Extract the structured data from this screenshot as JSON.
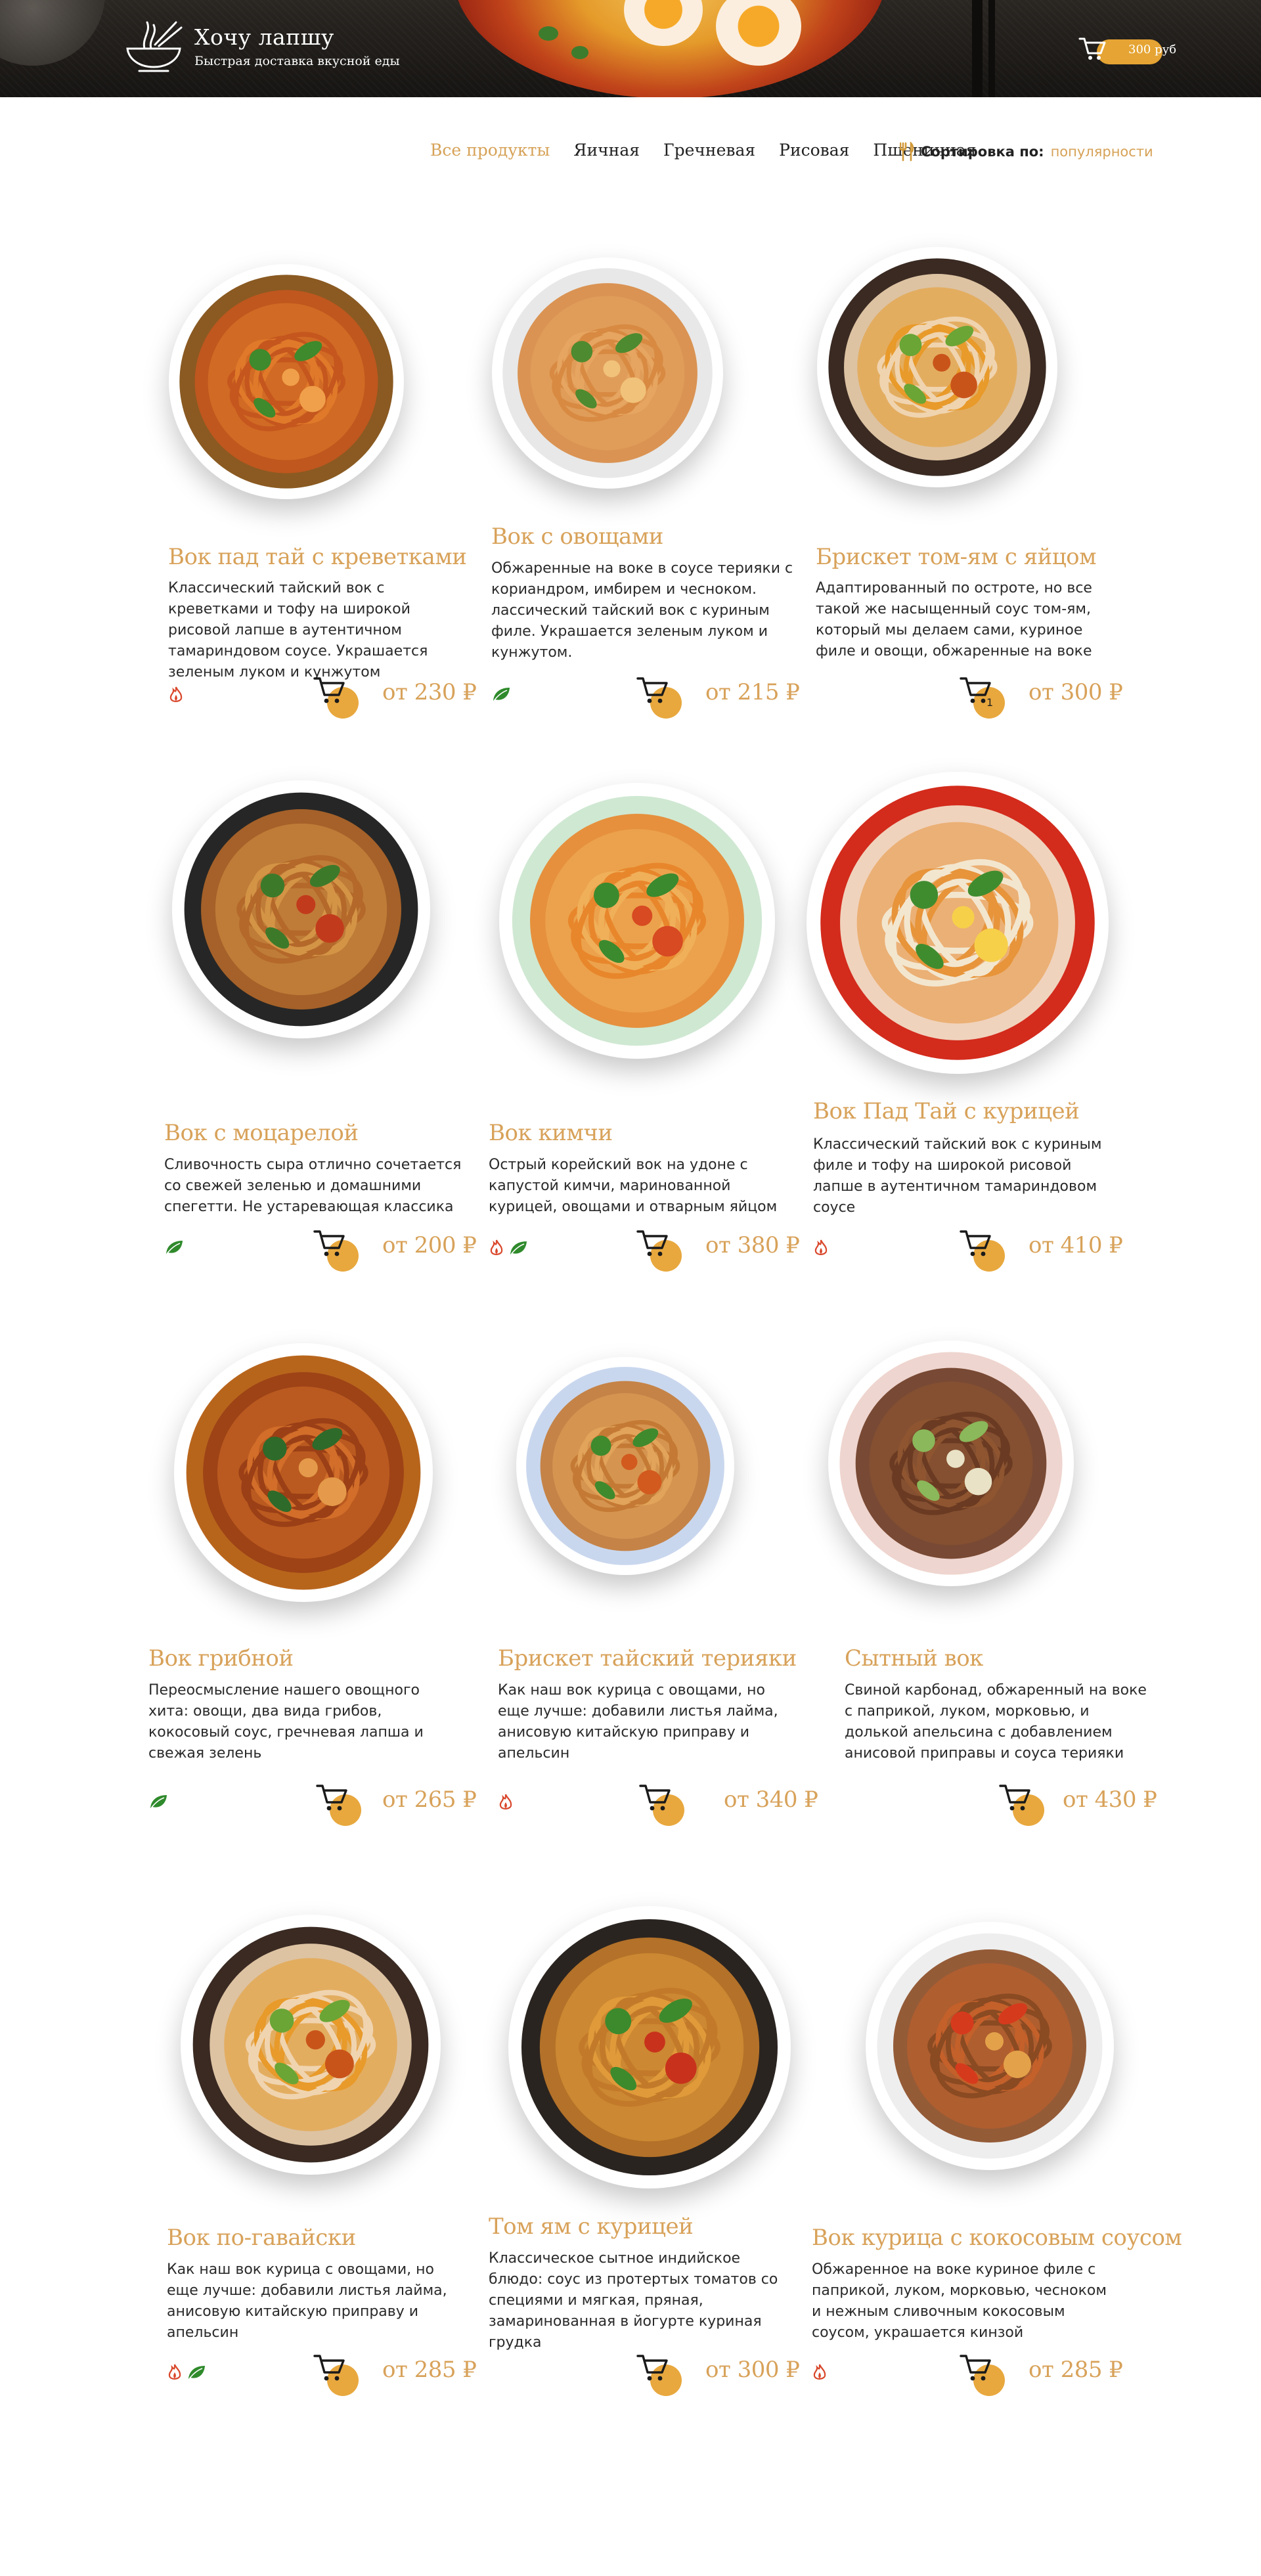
{
  "brand": {
    "title": "Хочу лапшу",
    "subtitle": "Быстрая доставка вкусной еды",
    "cart_total": "300 руб"
  },
  "nav": {
    "items": [
      "Все продукты",
      "Яичная",
      "Гречневая",
      "Рисовая",
      "Пшеничная"
    ],
    "active_index": 0
  },
  "sort": {
    "label": "Сортировка по:",
    "value": "популярности"
  },
  "colors": {
    "accent": "#d8a25a",
    "cart_dot": "#e8a83e",
    "spicy": "#d9472b",
    "vegan": "#2f8a2c"
  },
  "products": [
    {
      "title": "Вок пад тай с креветками",
      "desc": "Классический тайский вок с креветками и тофу на широкой рисовой лапше в аутентичном тамариндовом соусе. Украшается зеленым луком и кунжутом",
      "price": "от 230 ₽",
      "tags": [
        "spicy-icon"
      ],
      "cart_count": ""
    },
    {
      "title": "Вок с овощами",
      "desc": "Обжаренные на воке в соусе терияки с кориандром, имбирем и чесноком. лассический тайский вок с куриным филе. Украшается зеленым луком и кунжутом.",
      "price": "от 215 ₽",
      "tags": [
        "vegan-icon"
      ],
      "cart_count": ""
    },
    {
      "title": "Брискет том-ям с яйцом",
      "desc": "Адаптированный по остроте, но все такой же насыщенный соус том-ям, который мы делаем сами, куриное филе и овощи, обжаренные на воке",
      "price": "от 300 ₽",
      "tags": [],
      "cart_count": "1"
    },
    {
      "title": "Вок с моцарелой",
      "desc": "Сливочность сыра отлично сочетается со свежей зеленью и домашними спегетти. Не устаревающая классика",
      "price": "от 200 ₽",
      "tags": [
        "vegan-icon"
      ],
      "cart_count": ""
    },
    {
      "title": "Вок кимчи",
      "desc": "Острый корейский вок на удоне с капустой кимчи, маринованной курицей, овощами и отварным яйцом",
      "price": "от 380 ₽",
      "tags": [
        "spicy-icon",
        "vegan-icon"
      ],
      "cart_count": ""
    },
    {
      "title": "Вок Пад Тай с курицей",
      "desc": "Классический тайский вок с куриным филе и тофу на широкой рисовой лапше в аутентичном тамариндовом соусе",
      "price": "от 410 ₽",
      "tags": [
        "spicy-icon"
      ],
      "cart_count": ""
    },
    {
      "title": "Вок грибной",
      "desc": "Переосмысление нашего овощного хита: овощи, два вида грибов, кокосовый соус, гречневая лапша и свежая зелень",
      "price": "от 265 ₽",
      "tags": [
        "vegan-icon"
      ],
      "cart_count": ""
    },
    {
      "title": "Брискет тайский терияки",
      "desc": "Как наш вок курица с овощами, но еще лучше: добавили листья лайма, анисовую китайскую приправу и апельсин",
      "price": "от 340 ₽",
      "tags": [
        "spicy-icon"
      ],
      "cart_count": ""
    },
    {
      "title": "Сытный вок",
      "desc": "Свиной карбонад, обжаренный на воке с паприкой, луком, морковью, и долькой апельсина с добавлением анисовой приправы и соуса терияки",
      "price": "от 430 ₽",
      "tags": [],
      "cart_count": ""
    },
    {
      "title": "Вок по-гавайски",
      "desc": "Как наш вок курица с овощами, но еще лучше: добавили листья лайма, анисовую китайскую приправу и апельсин",
      "price": "от 285 ₽",
      "tags": [
        "spicy-icon",
        "vegan-icon"
      ],
      "cart_count": ""
    },
    {
      "title": "Том ям с курицей",
      "desc": "Классическое сытное индийское блюдо: соус из протертых томатов со специями и мягкая, пряная, замаринованная в йогурте куриная грудка",
      "price": "от 300 ₽",
      "tags": [],
      "cart_count": ""
    },
    {
      "title": "Вок курица с кокосовым соусом",
      "desc": "Обжаренное на воке куриное филе с паприкой, луком, морковью, чесноком и нежным сливочным кокосовым соусом, украшается кинзой",
      "price": "от 285 ₽",
      "tags": [
        "spicy-icon"
      ],
      "cart_count": ""
    }
  ]
}
